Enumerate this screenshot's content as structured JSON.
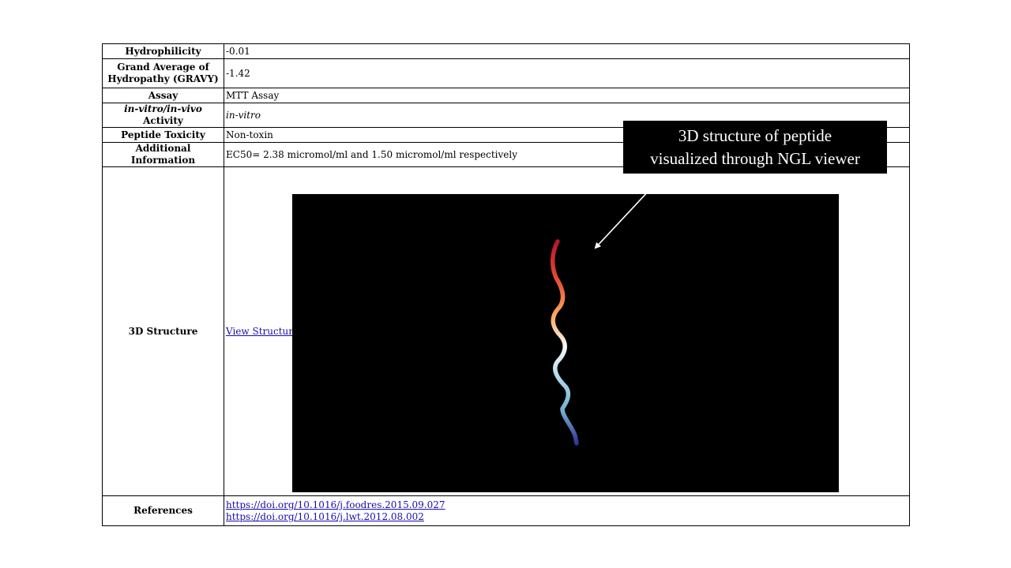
{
  "rows": {
    "hydrophilicity": {
      "label": "Hydrophilicity",
      "value": "-0.01"
    },
    "gravy": {
      "label_line1": "Grand Average of",
      "label_line2": "Hydropathy (GRAVY)",
      "value": "-1.42"
    },
    "assay": {
      "label": "Assay",
      "value": "MTT Assay"
    },
    "activity": {
      "label_italic": "in-vitro/in-vivo",
      "label_rest": " Activity",
      "value": "in-vitro"
    },
    "toxicity": {
      "label": "Peptide Toxicity",
      "value": "Non-toxin"
    },
    "additional": {
      "label": "Additional Information",
      "value": "EC50= 2.38 micromol/ml and 1.50 micromol/ml respectively"
    },
    "structure": {
      "label": "3D Structure",
      "link": "View Structure"
    },
    "references": {
      "label": "References",
      "links": [
        "https://doi.org/10.1016/j.foodres.2015.09.027",
        "https://doi.org/10.1016/j.lwt.2012.08.002"
      ]
    }
  },
  "callout": {
    "line1": "3D structure of peptide",
    "line2": "visualized through NGL viewer"
  },
  "viewer": {
    "background": "#000000",
    "gradient_colors": [
      "#b2182b",
      "#e34a33",
      "#fdae61",
      "#f7f7f7",
      "#abd9e9",
      "#74add1",
      "#313695"
    ]
  }
}
